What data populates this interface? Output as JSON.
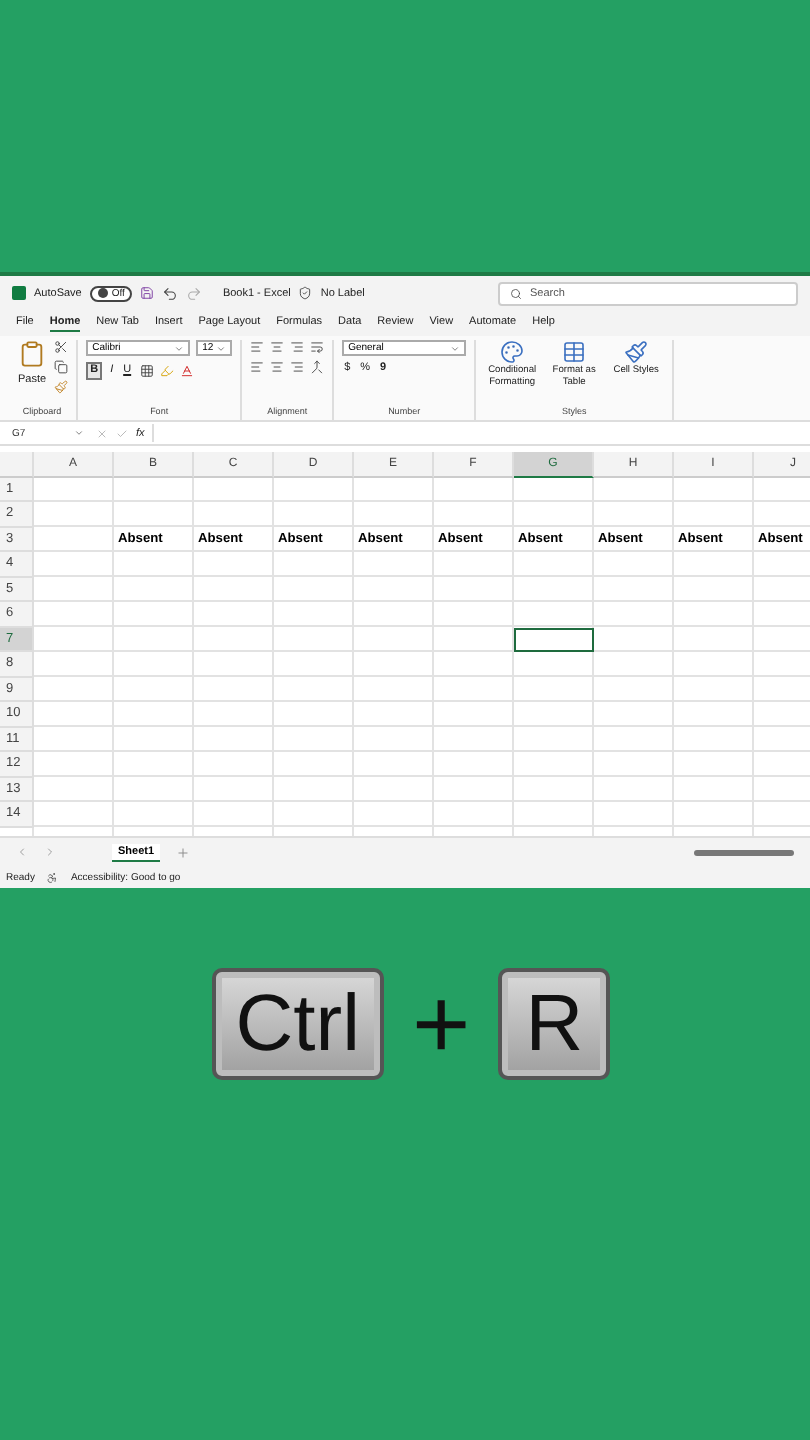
{
  "title_bar": {
    "autosave": "AutoSave",
    "toggle": "Off",
    "on": false,
    "document": "Book1 - Excel",
    "label": "No Label",
    "search": {
      "placeholder": "Search"
    }
  },
  "menu_tabs": [
    {
      "label": "File",
      "selected": false
    },
    {
      "label": "Home",
      "selected": true
    },
    {
      "label": "New Tab",
      "selected": false
    },
    {
      "label": "Insert",
      "selected": false
    },
    {
      "label": "Page Layout",
      "selected": false
    },
    {
      "label": "Formulas",
      "selected": false
    },
    {
      "label": "Data",
      "selected": false
    },
    {
      "label": "Review",
      "selected": false
    },
    {
      "label": "View",
      "selected": false
    },
    {
      "label": "Automate",
      "selected": false
    },
    {
      "label": "Help",
      "selected": false
    }
  ],
  "ribbon": {
    "clipboard": {
      "label": "Clipboard",
      "paste": "Paste"
    },
    "font": {
      "label": "Font",
      "font_name": "Calibri",
      "font_size": "12",
      "bold": "B",
      "italic": "I",
      "underline": "U"
    },
    "alignment": {
      "label": "Alignment"
    },
    "number": {
      "label": "Number",
      "format": "General",
      "currency": "$",
      "percent": "%",
      "comma": "9"
    },
    "styles": {
      "label": "Styles",
      "buttons": [
        "Conditional Formatting",
        "Format as Table",
        "Cell Styles"
      ]
    }
  },
  "name_box": "G7",
  "formula_bar": {
    "fx": "fx"
  },
  "columns": [
    {
      "label": "A",
      "selected": false
    },
    {
      "label": "B",
      "selected": false
    },
    {
      "label": "C",
      "selected": false
    },
    {
      "label": "D",
      "selected": false
    },
    {
      "label": "E",
      "selected": false
    },
    {
      "label": "F",
      "selected": false
    },
    {
      "label": "G",
      "selected": true
    },
    {
      "label": "H",
      "selected": false
    },
    {
      "label": "I",
      "selected": false
    },
    {
      "label": "J",
      "selected": false
    }
  ],
  "rows": [
    {
      "label": "1",
      "selected": false,
      "cells": []
    },
    {
      "label": "2",
      "selected": false,
      "cells": []
    },
    {
      "label": "3",
      "selected": false,
      "cells": [
        "",
        "Absent",
        "Absent",
        "Absent",
        "Absent",
        "Absent",
        "Absent",
        "Absent",
        "Absent",
        "Absent"
      ]
    },
    {
      "label": "4",
      "selected": false,
      "cells": []
    },
    {
      "label": "5",
      "selected": false,
      "cells": []
    },
    {
      "label": "6",
      "selected": false,
      "cells": []
    },
    {
      "label": "7",
      "selected": true,
      "cells": []
    },
    {
      "label": "8",
      "selected": false,
      "cells": []
    },
    {
      "label": "9",
      "selected": false,
      "cells": []
    },
    {
      "label": "10",
      "selected": false,
      "cells": []
    },
    {
      "label": "11",
      "selected": false,
      "cells": []
    },
    {
      "label": "12",
      "selected": false,
      "cells": []
    },
    {
      "label": "13",
      "selected": false,
      "cells": []
    },
    {
      "label": "14",
      "selected": false,
      "cells": []
    }
  ],
  "sheet_tabs": [
    {
      "label": "Sheet1",
      "selected": true
    }
  ],
  "status_bar": {
    "status": "Ready",
    "accessibility": "Accessibility: Good to go"
  },
  "shortcut": [
    {
      "kind": "key",
      "label": "Ctrl"
    },
    {
      "kind": "plus",
      "label": "+"
    },
    {
      "kind": "key",
      "label": "R"
    }
  ]
}
